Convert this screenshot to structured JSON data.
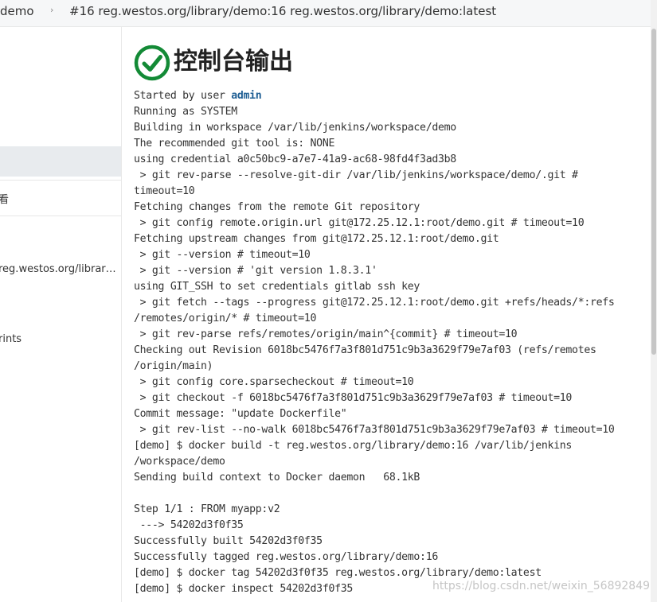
{
  "breadcrumb": {
    "job": "demo",
    "separator": "›",
    "build": "#16 reg.westos.org/library/demo:16 reg.westos.org/library/demo:latest"
  },
  "sidebar": {
    "items": [
      {
        "label": "看"
      },
      {
        "label": "reg.westos.org/librar…"
      },
      {
        "label": "rints"
      }
    ]
  },
  "main": {
    "title": "控制台输出",
    "status_icon": "check-circle-icon",
    "status_color": "#138a36",
    "started_by_prefix": "Started by user ",
    "started_by_user": "admin",
    "console_lines": [
      "Running as SYSTEM",
      "Building in workspace /var/lib/jenkins/workspace/demo",
      "The recommended git tool is: NONE",
      "using credential a0c50bc9-a7e7-41a9-ac68-98fd4f3ad3b8",
      " > git rev-parse --resolve-git-dir /var/lib/jenkins/workspace/demo/.git #",
      "timeout=10",
      "Fetching changes from the remote Git repository",
      " > git config remote.origin.url git@172.25.12.1:root/demo.git # timeout=10",
      "Fetching upstream changes from git@172.25.12.1:root/demo.git",
      " > git --version # timeout=10",
      " > git --version # 'git version 1.8.3.1'",
      "using GIT_SSH to set credentials gitlab ssh key",
      " > git fetch --tags --progress git@172.25.12.1:root/demo.git +refs/heads/*:refs",
      "/remotes/origin/* # timeout=10",
      " > git rev-parse refs/remotes/origin/main^{commit} # timeout=10",
      "Checking out Revision 6018bc5476f7a3f801d751c9b3a3629f79e7af03 (refs/remotes",
      "/origin/main)",
      " > git config core.sparsecheckout # timeout=10",
      " > git checkout -f 6018bc5476f7a3f801d751c9b3a3629f79e7af03 # timeout=10",
      "Commit message: \"update Dockerfile\"",
      " > git rev-list --no-walk 6018bc5476f7a3f801d751c9b3a3629f79e7af03 # timeout=10",
      "[demo] $ docker build -t reg.westos.org/library/demo:16 /var/lib/jenkins",
      "/workspace/demo",
      "Sending build context to Docker daemon   68.1kB",
      "",
      "Step 1/1 : FROM myapp:v2",
      " ---> 54202d3f0f35",
      "Successfully built 54202d3f0f35",
      "Successfully tagged reg.westos.org/library/demo:16",
      "[demo] $ docker tag 54202d3f0f35 reg.westos.org/library/demo:latest",
      "[demo] $ docker inspect 54202d3f0f35"
    ]
  },
  "watermark": "https://blog.csdn.net/weixin_56892849"
}
